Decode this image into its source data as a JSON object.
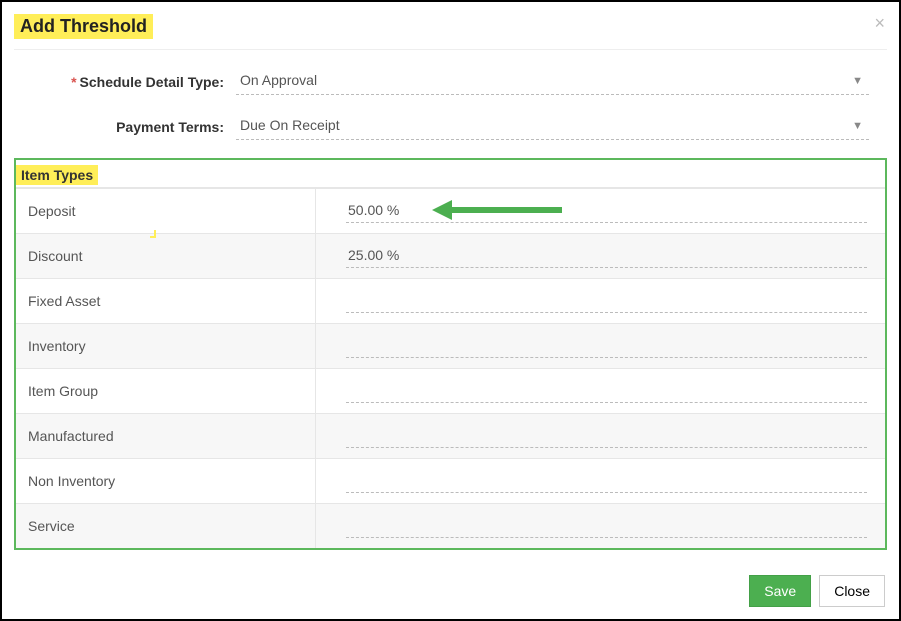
{
  "modal": {
    "title": "Add Threshold",
    "close_glyph": "×"
  },
  "form": {
    "scheduleDetailType": {
      "label": "Schedule Detail Type:",
      "required": true,
      "value": "On Approval"
    },
    "paymentTerms": {
      "label": "Payment Terms:",
      "required": false,
      "value": "Due On Receipt"
    }
  },
  "itemTypes": {
    "header": "Item Types",
    "rows": [
      {
        "label": "Deposit",
        "value": "50.00 %"
      },
      {
        "label": "Discount",
        "value": "25.00 %"
      },
      {
        "label": "Fixed Asset",
        "value": ""
      },
      {
        "label": "Inventory",
        "value": ""
      },
      {
        "label": "Item Group",
        "value": ""
      },
      {
        "label": "Manufactured",
        "value": ""
      },
      {
        "label": "Non Inventory",
        "value": ""
      },
      {
        "label": "Service",
        "value": ""
      }
    ]
  },
  "footer": {
    "save": "Save",
    "close": "Close"
  },
  "annotation": {
    "arrow_color": "#4caf50",
    "highlight_color": "#ffee58"
  }
}
